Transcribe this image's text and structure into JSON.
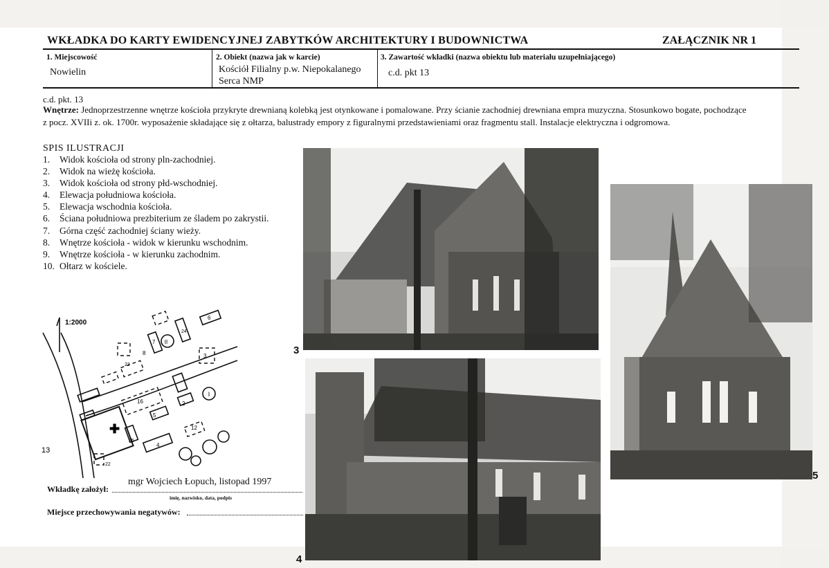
{
  "header": {
    "title": "WKŁADKA DO KARTY EWIDENCYJNEJ ZABYTKÓW ARCHITEKTURY I BUDOWNICTWA",
    "attachment": "ZAŁĄCZNIK NR 1"
  },
  "fields": {
    "locality_label": "1. Miejscowość",
    "locality_value": "Nowielin",
    "object_label": "2. Obiekt (nazwa jak w karcie)",
    "object_value_line1": "Kościół Filialny p.w. Niepokalanego",
    "object_value_line2": "Serca NMP",
    "content_label": "3. Zawartość wkładki (nazwa obiektu lub materiału uzupełniającego)",
    "content_value": "c.d. pkt 13"
  },
  "description": {
    "continuation": "c.d. pkt. 13",
    "heading": "Wnętrze:",
    "line1": " Jednoprzestrzenne wnętrze kościoła przykryte drewnianą kolebką jest otynkowane i pomalowane. Przy ścianie zachodniej drewniana empra muzyczna. Stosunkowo bogate, pochodzące",
    "line2": "z pocz. XVIIi z. ok. 1700r. wyposażenie składające się z ołtarza, balustrady empory z figuralnymi przedstawieniami oraz fragmentu stall. Instalacje elektryczna i odgromowa."
  },
  "illustrations": {
    "title": "SPIS ILUSTRACJI",
    "items": [
      {
        "num": "1.",
        "text": "Widok kościoła od strony pln-zachodniej."
      },
      {
        "num": "2.",
        "text": "Widok na wieżę kościoła."
      },
      {
        "num": "3.",
        "text": "Widok kościoła od strony płd-wschodniej."
      },
      {
        "num": "4.",
        "text": "Elewacja południowa kościoła."
      },
      {
        "num": "5.",
        "text": "Elewacja wschodnia kościoła."
      },
      {
        "num": "6.",
        "text": "Ściana południowa prezbiterium ze śladem po zakrystii."
      },
      {
        "num": "7.",
        "text": "Górna część zachodniej ściany wieży."
      },
      {
        "num": "8.",
        "text": "Wnętrze kościoła - widok w kierunku wschodnim."
      },
      {
        "num": "9.",
        "text": "Wnętrze kościoła - w kierunku zachodnim."
      },
      {
        "num": "10.",
        "text": "Ołtarz w kościele."
      }
    ]
  },
  "map": {
    "scale": "1:2000",
    "labels": [
      "13",
      "2",
      "3",
      "4",
      "5",
      "6",
      "7",
      "8",
      "12",
      "16",
      "22",
      "23",
      "24",
      "25",
      "I",
      "II"
    ]
  },
  "photos": {
    "photo3_number": "3",
    "photo4_number": "4",
    "photo5_number": "5"
  },
  "signature": {
    "created_by_label": "Wkładkę założył:",
    "created_by_value": "mgr Wojciech Łopuch, listopad 1997",
    "created_by_hint": "imię, nazwisko, data, podpis",
    "storage_label": "Miejsce przechowywania negatywów:"
  }
}
